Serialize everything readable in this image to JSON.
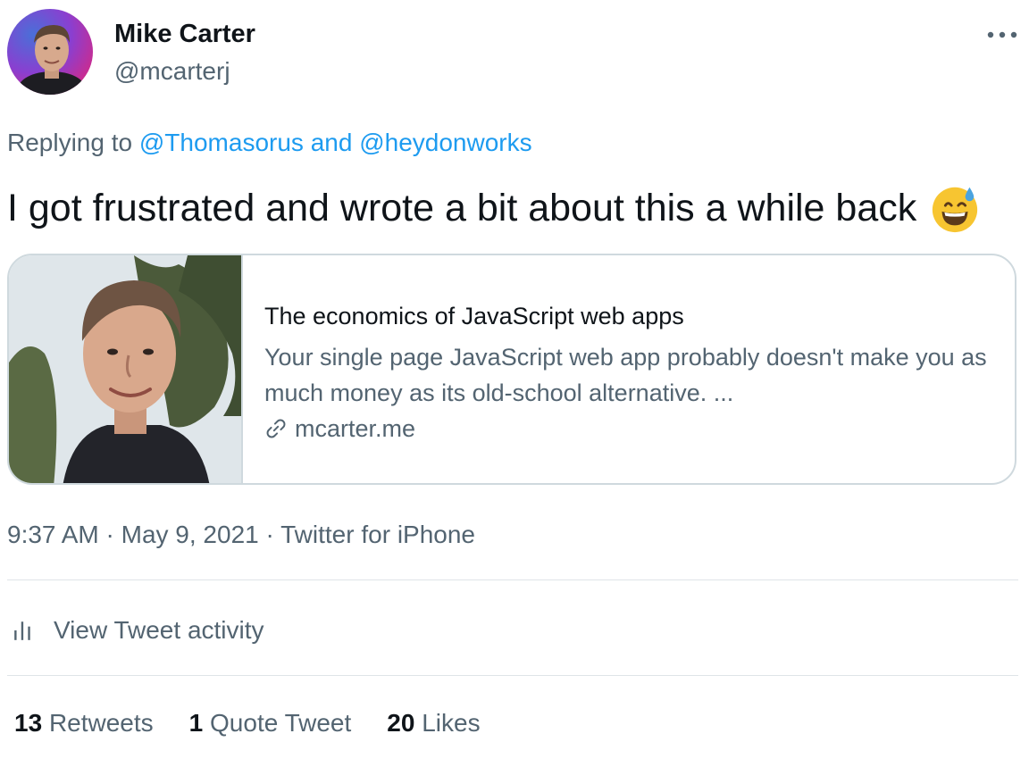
{
  "author": {
    "display_name": "Mike Carter",
    "handle": "@mcarterj",
    "avatar_icon": "profile-photo"
  },
  "more_icon": "ellipsis-icon",
  "reply": {
    "prefix": "Replying to ",
    "mention1": "@Thomasorus",
    "conjunction": " and ",
    "mention2": "@heydonworks"
  },
  "tweet": {
    "text": "I got frustrated and wrote a bit about this a while back",
    "emoji": "grinning-face-with-sweat"
  },
  "card": {
    "title": "The economics of JavaScript web apps",
    "description": "Your single page JavaScript web app probably doesn't make you as much money as its old-school alternative. ...",
    "domain": "mcarter.me",
    "domain_icon": "link-icon"
  },
  "meta": {
    "time": "9:37 AM",
    "sep1": " · ",
    "date": "May 9, 2021",
    "sep2": " · ",
    "source": "Twitter for iPhone"
  },
  "activity": {
    "label": "View Tweet activity",
    "icon": "bar-chart-icon"
  },
  "stats": {
    "retweets_count": "13",
    "retweets_label": "Retweets",
    "quotes_count": "1",
    "quotes_label": "Quote Tweet",
    "likes_count": "20",
    "likes_label": "Likes"
  },
  "colors": {
    "link": "#1d9bf0",
    "secondary_text": "#536471",
    "primary_text": "#0f1419",
    "border": "#cfd9de"
  }
}
